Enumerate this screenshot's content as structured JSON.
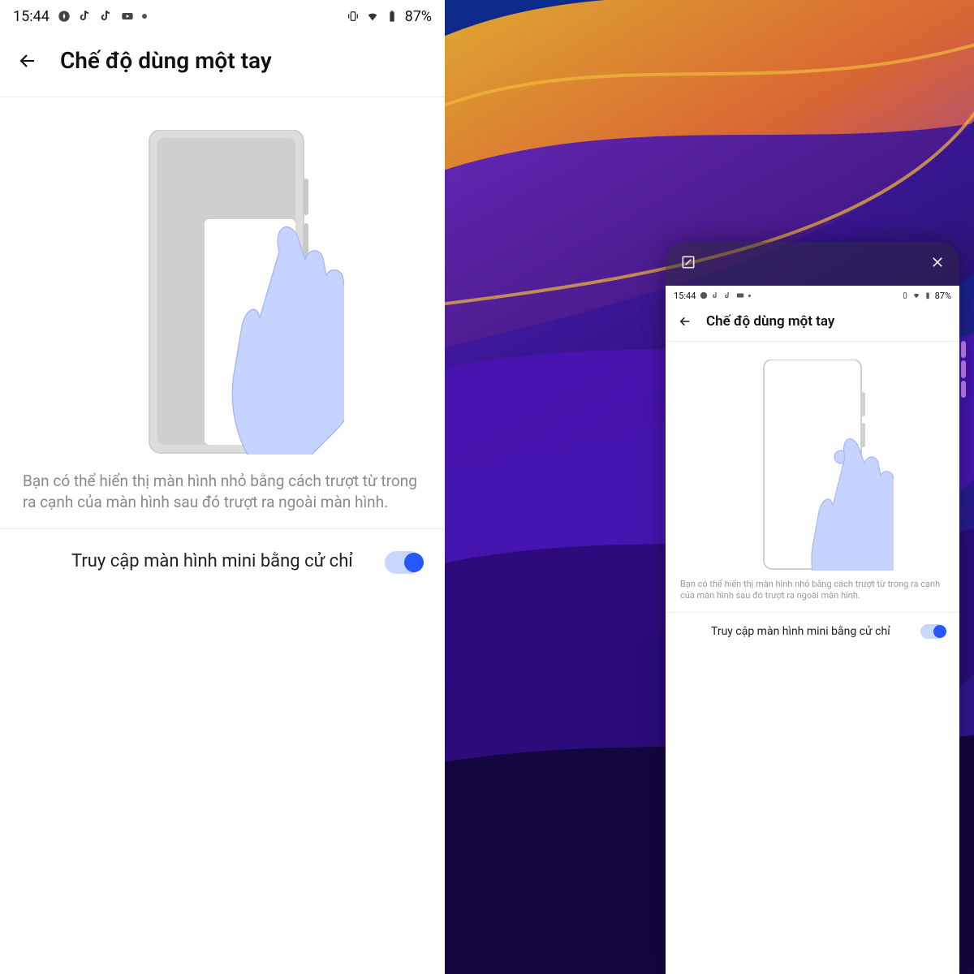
{
  "status": {
    "time": "15:44",
    "battery": "87%"
  },
  "page": {
    "title": "Chế độ dùng một tay",
    "description": "Bạn có thể hiển thị màn hình nhỏ bằng cách trượt từ trong ra cạnh của màn hình sau đó trượt ra ngoài màn hình.",
    "toggle_label": "Truy cập màn hình mini bằng cử chỉ",
    "toggle_on": true
  },
  "mini": {
    "status_time": "15:44",
    "battery": "87%",
    "title": "Chế độ dùng một tay",
    "description": "Bạn có thể hiển thị màn hình nhỏ bằng cách trượt từ trong ra cạnh của màn hình sau đó trượt ra ngoài màn hình.",
    "toggle_label": "Truy cập màn hình mini bằng cử chỉ",
    "toggle_on": true
  },
  "colors": {
    "accent": "#2559ff"
  }
}
